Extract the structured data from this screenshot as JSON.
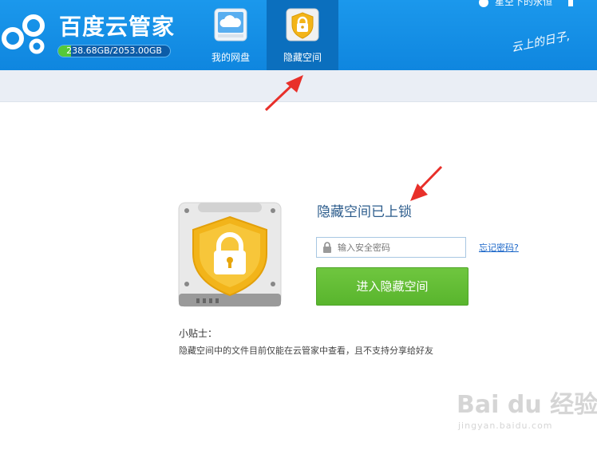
{
  "header": {
    "app_title": "百度云管家",
    "quota_text": "238.68GB/2053.00GB",
    "quota_used_fraction": 0.116,
    "tabs": [
      {
        "label": "我的网盘",
        "icon": "cloud-drive-icon"
      },
      {
        "label": "隐藏空间",
        "icon": "lock-shield-icon"
      }
    ],
    "username": "星空下的永恒",
    "slogan": "云上的日子,"
  },
  "main": {
    "locked_title": "隐藏空间已上锁",
    "password_placeholder": "输入安全密码",
    "forgot_link": "忘记密码?",
    "enter_button": "进入隐藏空间",
    "tip_title": "小贴士：",
    "tip_text": "隐藏空间中的文件目前仅能在云管家中查看，且不支持分享给好友"
  },
  "watermark": {
    "brand": "Bai du 经验",
    "site": "jingyan.baidu.com"
  },
  "colors": {
    "header_blue": "#0f86df",
    "active_tab": "#0b6fbe",
    "button_green": "#5fba33",
    "arrow_red": "#e8302a"
  }
}
